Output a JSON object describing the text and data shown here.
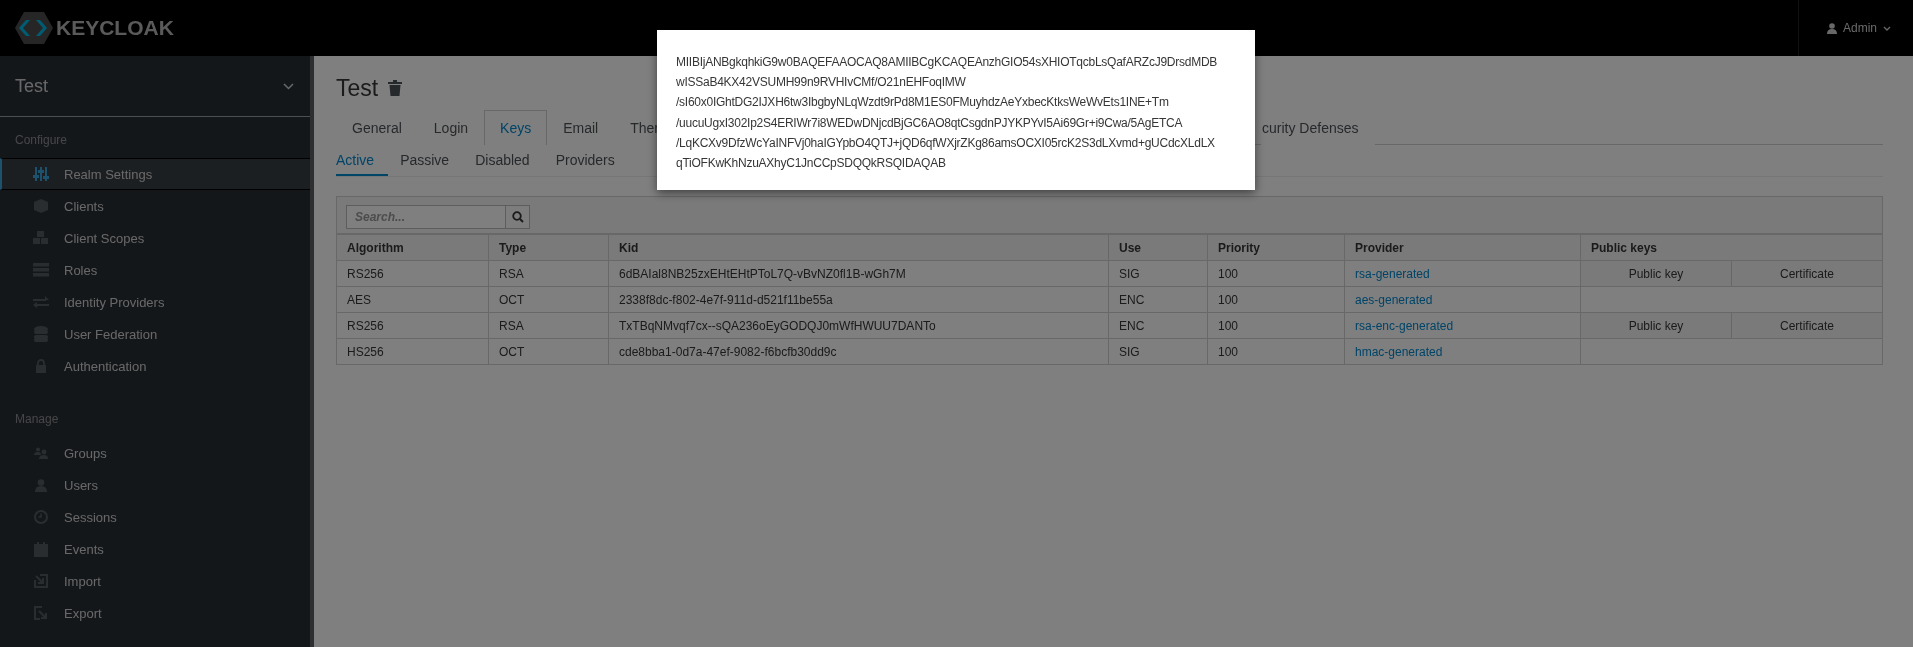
{
  "header": {
    "logo": "KEYCLOAK",
    "user_menu": "Admin"
  },
  "sidebar": {
    "realm": "Test",
    "sections": [
      {
        "heading": "Configure",
        "items": [
          {
            "label": "Realm Settings",
            "selected": true
          },
          {
            "label": "Clients",
            "selected": false
          },
          {
            "label": "Client Scopes",
            "selected": false
          },
          {
            "label": "Roles",
            "selected": false
          },
          {
            "label": "Identity Providers",
            "selected": false
          },
          {
            "label": "User Federation",
            "selected": false
          },
          {
            "label": "Authentication",
            "selected": false
          }
        ]
      },
      {
        "heading": "Manage",
        "items": [
          {
            "label": "Groups",
            "selected": false
          },
          {
            "label": "Users",
            "selected": false
          },
          {
            "label": "Sessions",
            "selected": false
          },
          {
            "label": "Events",
            "selected": false
          },
          {
            "label": "Import",
            "selected": false
          },
          {
            "label": "Export",
            "selected": false
          }
        ]
      }
    ]
  },
  "main": {
    "title": "Test",
    "tabs": [
      {
        "label": "General",
        "selected": false
      },
      {
        "label": "Login",
        "selected": false
      },
      {
        "label": "Keys",
        "selected": true
      },
      {
        "label": "Email",
        "selected": false
      },
      {
        "label": "Ther",
        "selected": false
      },
      {
        "label": "curity Defenses",
        "selected": false
      }
    ],
    "subtabs": [
      {
        "label": "Active",
        "selected": true
      },
      {
        "label": "Passive",
        "selected": false
      },
      {
        "label": "Disabled",
        "selected": false
      },
      {
        "label": "Providers",
        "selected": false
      }
    ],
    "search": {
      "placeholder": "Search..."
    },
    "table": {
      "columns": [
        "Algorithm",
        "Type",
        "Kid",
        "Use",
        "Priority",
        "Provider",
        "Public keys"
      ],
      "rows": [
        {
          "algorithm": "RS256",
          "type": "RSA",
          "kid": "6dBAIal8NB25zxEHtEHtPToL7Q-vBvNZ0fl1B-wGh7M",
          "use": "SIG",
          "priority": "100",
          "provider": "rsa-generated",
          "public_keys": [
            "Public key",
            "Certificate"
          ]
        },
        {
          "algorithm": "AES",
          "type": "OCT",
          "kid": "2338f8dc-f802-4e7f-911d-d521f11be55a",
          "use": "ENC",
          "priority": "100",
          "provider": "aes-generated"
        },
        {
          "algorithm": "RS256",
          "type": "RSA",
          "kid": "TxTBqNMvqf7cx--sQA236oEyGODQJ0mWfHWUU7DANTo",
          "use": "ENC",
          "priority": "100",
          "provider": "rsa-enc-generated",
          "public_keys": [
            "Public key",
            "Certificate"
          ]
        },
        {
          "algorithm": "HS256",
          "type": "OCT",
          "kid": "cde8bba1-0d7a-47ef-9082-f6bcfb30dd9c",
          "use": "SIG",
          "priority": "100",
          "provider": "hmac-generated"
        }
      ]
    }
  },
  "modal": {
    "key_lines": [
      "MIIBIjANBgkqhkiG9w0BAQEFAAOCAQ8AMIIBCgKCAQEAnzhGIO54sXHIOTqcbLsQafARZcJ9DrsdMDB",
      "wISSaB4KX42VSUMH99n9RVHIvCMf/O21nEHFoqIMW",
      "/sI60x0IGhtDG2IJXH6tw3IbgbyNLqWzdt9rPd8M1ES0FMuyhdzAeYxbecKtksWeWvEts1INE+Tm",
      "/uucuUgxI302Ip2S4ERIWr7i8WEDwDNjcdBjGC6AO8qtCsgdnPJYKPYvI5Ai69Gr+i9Cwa/5AgETCA",
      "/LqKCXv9DfzWcYaINFVj0haIGYpbO4QTJ+jQD6qfWXjrZKg86amsOCXI05rcK2S3dLXvmd+gUCdcXLdLX",
      "qTiOFKwKhNzuAXhyC1JnCCpSDQQkRSQIDAQAB"
    ]
  }
}
